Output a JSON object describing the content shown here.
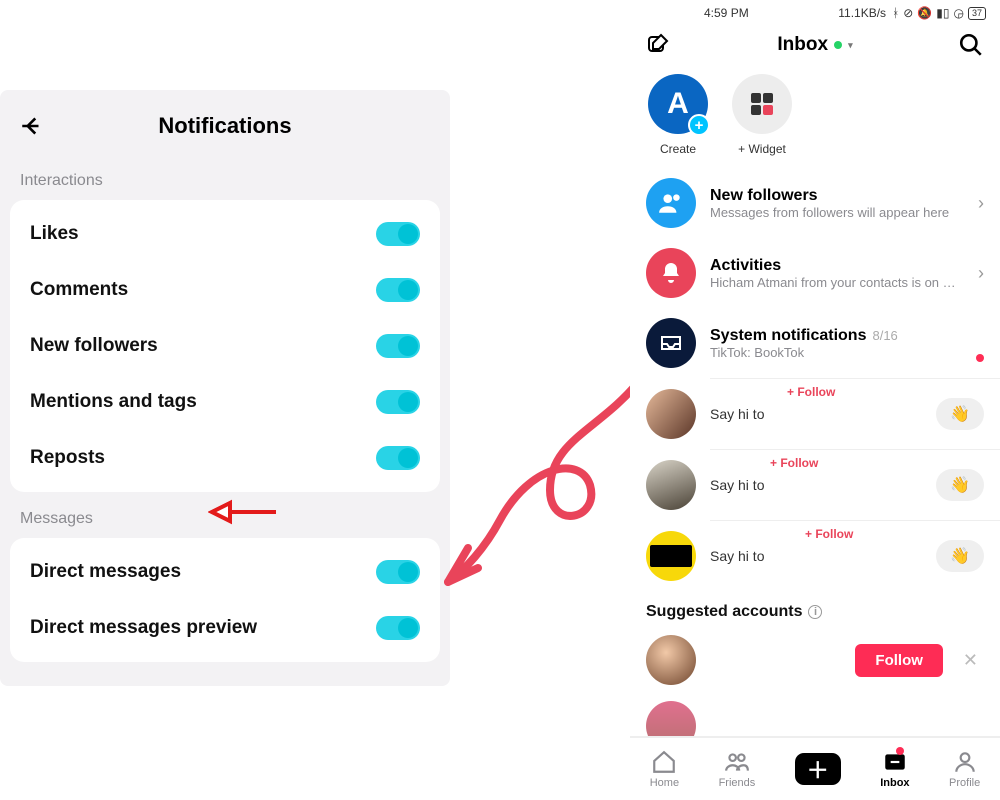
{
  "left": {
    "title": "Notifications",
    "section_interactions": "Interactions",
    "section_messages": "Messages",
    "rows_interactions": [
      {
        "label": "Likes"
      },
      {
        "label": "Comments"
      },
      {
        "label": "New followers"
      },
      {
        "label": "Mentions and tags"
      },
      {
        "label": "Reposts"
      }
    ],
    "rows_messages": [
      {
        "label": "Direct messages"
      },
      {
        "label": "Direct messages preview"
      }
    ]
  },
  "right": {
    "status": {
      "time": "4:59 PM",
      "net": "11.1KB/s",
      "battery": "37"
    },
    "header": {
      "title": "Inbox"
    },
    "circles": {
      "create": "Create",
      "create_letter": "A",
      "widget": "+ Widget"
    },
    "feed": {
      "new_followers": {
        "title": "New followers",
        "sub": "Messages from followers will appear here"
      },
      "activities": {
        "title": "Activities",
        "sub": "Hicham Atmani from your contacts is on …"
      },
      "system": {
        "title": "System notifications",
        "meta": "8/16",
        "sub": "TikTok: BookTok"
      }
    },
    "say_hi_label": "Say hi to",
    "follow_tag": "+ Follow",
    "wave_emoji": "👋",
    "suggested_header": "Suggested accounts",
    "follow_btn": "Follow",
    "bottombar": {
      "home": "Home",
      "friends": "Friends",
      "inbox": "Inbox",
      "profile": "Profile"
    }
  }
}
